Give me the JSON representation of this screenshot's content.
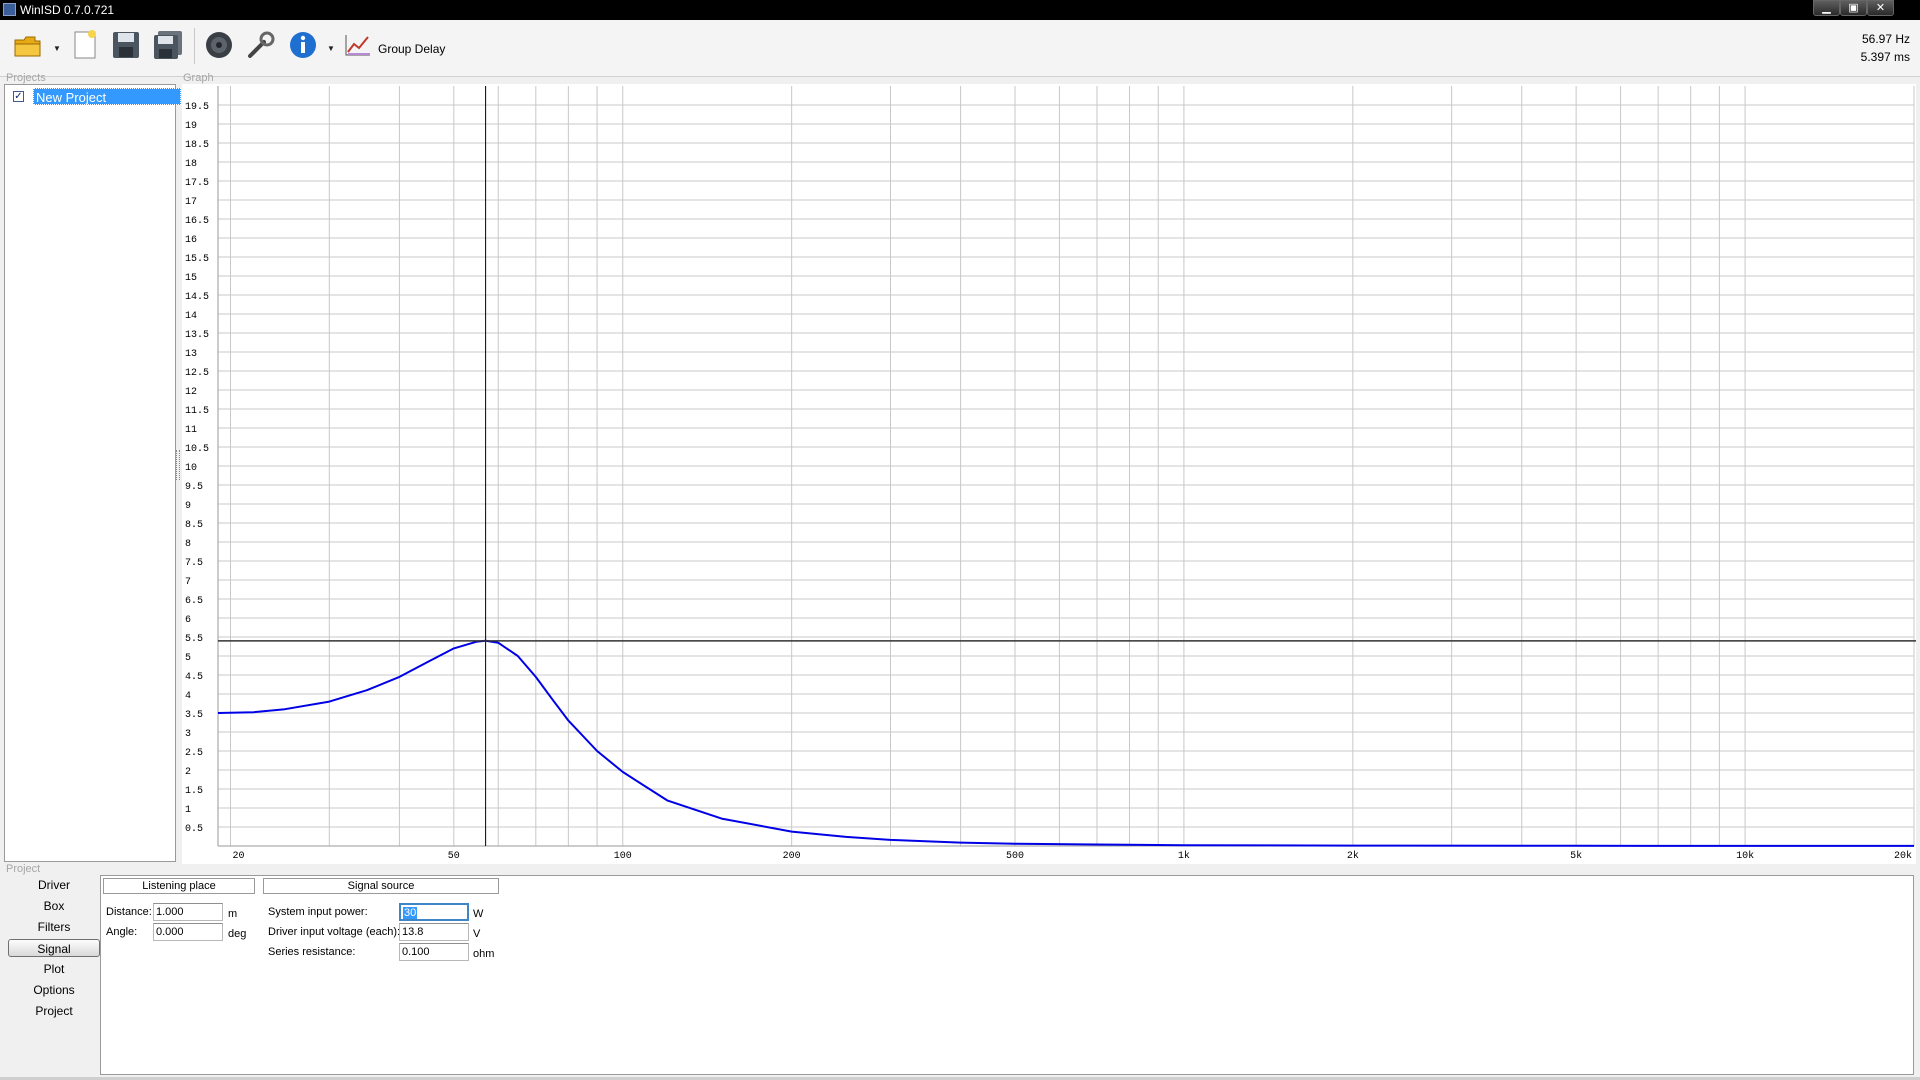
{
  "window": {
    "title": "WinISD 0.7.0.721",
    "minimize": "▁",
    "maximize": "▣",
    "close": "✕"
  },
  "toolbar": {
    "items": [
      "open-folder-icon",
      "new-project-icon",
      "save-icon",
      "save-all-icon",
      "driver-editor-icon",
      "tools-icon",
      "info-icon",
      "group-delay-icon"
    ],
    "graph_selector_label": "Group Delay",
    "readout_freq": "56.97 Hz",
    "readout_value": "5.397 ms"
  },
  "projects": {
    "group_label": "Projects",
    "items": [
      {
        "name": "New Project",
        "checked": true,
        "checkmark": "✓"
      }
    ]
  },
  "graph": {
    "group_label": "Graph",
    "line_color": "#0000e6",
    "cursor": {
      "freq_hz": 56.97,
      "value_ms": 5.397
    }
  },
  "chart_data": {
    "type": "line",
    "title": "",
    "xlabel": "",
    "ylabel": "",
    "xscale": "log",
    "xlim": [
      19,
      20000
    ],
    "ylim": [
      0,
      20
    ],
    "grid": true,
    "x_tick_labels": [
      {
        "x": 20,
        "label": "20"
      },
      {
        "x": 50,
        "label": "50"
      },
      {
        "x": 100,
        "label": "100"
      },
      {
        "x": 200,
        "label": "200"
      },
      {
        "x": 500,
        "label": "500"
      },
      {
        "x": 1000,
        "label": "1k"
      },
      {
        "x": 2000,
        "label": "2k"
      },
      {
        "x": 5000,
        "label": "5k"
      },
      {
        "x": 10000,
        "label": "10k"
      },
      {
        "x": 20000,
        "label": "20k"
      }
    ],
    "y_tick_labels": [
      "0.5",
      "1",
      "1.5",
      "2",
      "2.5",
      "3",
      "3.5",
      "4",
      "4.5",
      "5",
      "5.5",
      "6",
      "6.5",
      "7",
      "7.5",
      "8",
      "8.5",
      "9",
      "9.5",
      "10",
      "10.5",
      "11",
      "11.5",
      "12",
      "12.5",
      "13",
      "13.5",
      "14",
      "14.5",
      "15",
      "15.5",
      "16",
      "16.5",
      "17",
      "17.5",
      "18",
      "18.5",
      "19",
      "19.5"
    ],
    "series": [
      {
        "x": [
          19,
          22,
          25,
          30,
          35,
          40,
          45,
          50,
          55,
          57,
          60,
          65,
          70,
          75,
          80,
          90,
          100,
          120,
          150,
          200,
          250,
          300,
          400,
          500,
          700,
          1000,
          2000,
          5000,
          10000,
          20000
        ],
        "y": [
          3.5,
          3.52,
          3.6,
          3.8,
          4.1,
          4.45,
          4.85,
          5.2,
          5.38,
          5.4,
          5.35,
          5.0,
          4.45,
          3.85,
          3.3,
          2.5,
          1.95,
          1.2,
          0.72,
          0.38,
          0.24,
          0.16,
          0.09,
          0.06,
          0.04,
          0.02,
          0.01,
          0.005,
          0.003,
          0.002
        ]
      }
    ]
  },
  "project_section": {
    "group_label": "Project",
    "tabs": [
      "Driver",
      "Box",
      "Filters",
      "Signal",
      "Plot",
      "Options",
      "Project"
    ],
    "active_tab": "Signal"
  },
  "signal": {
    "listening_place": {
      "header": "Listening place",
      "distance_label": "Distance:",
      "distance_value": "1.000",
      "distance_unit": "m",
      "angle_label": "Angle:",
      "angle_value": "0.000",
      "angle_unit": "deg"
    },
    "signal_source": {
      "header": "Signal source",
      "power_label": "System input power:",
      "power_value": "30",
      "power_unit": "W",
      "voltage_label": "Driver input voltage (each):",
      "voltage_value": "13.8",
      "voltage_unit": "V",
      "resistance_label": "Series resistance:",
      "resistance_value": "0.100",
      "resistance_unit": "ohm"
    }
  }
}
